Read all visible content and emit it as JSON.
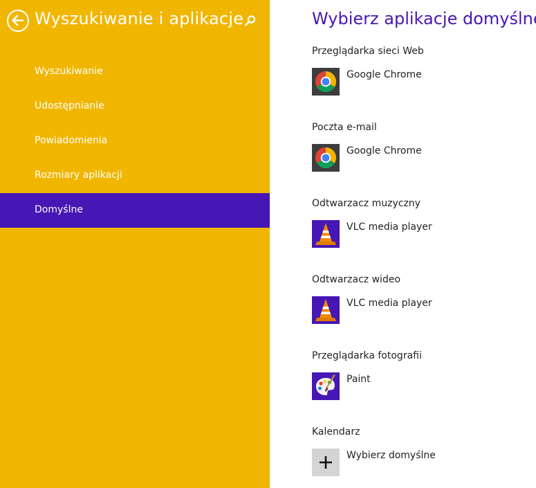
{
  "sidebar": {
    "title": "Wyszukiwanie i aplikacje",
    "bg_color": "#f1b602",
    "selected_color": "#4617b4",
    "items": [
      {
        "label": "Wyszukiwanie"
      },
      {
        "label": "Udostępnianie"
      },
      {
        "label": "Powiadomienia"
      },
      {
        "label": "Rozmiary aplikacji"
      },
      {
        "label": "Domyślne",
        "selected": true
      }
    ]
  },
  "main": {
    "title": "Wybierz aplikacje domyślne",
    "title_color": "#4617b4",
    "defaults": [
      {
        "category": "Przeglądarka sieci Web",
        "app": "Google Chrome",
        "icon": "chrome-icon"
      },
      {
        "category": "Poczta e-mail",
        "app": "Google Chrome",
        "icon": "chrome-icon"
      },
      {
        "category": "Odtwarzacz muzyczny",
        "app": "VLC media player",
        "icon": "vlc-icon"
      },
      {
        "category": "Odtwarzacz wideo",
        "app": "VLC media player",
        "icon": "vlc-icon"
      },
      {
        "category": "Przeglądarka fotografii",
        "app": "Paint",
        "icon": "paint-icon"
      },
      {
        "category": "Kalendarz",
        "app": "Wybierz domyślne",
        "icon": "plus-icon"
      }
    ]
  }
}
